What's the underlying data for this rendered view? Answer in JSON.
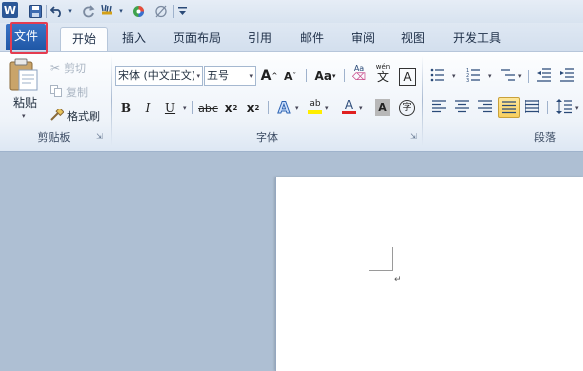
{
  "quick_access": {
    "word_icon_text": "W",
    "icons": [
      "save-icon",
      "undo-icon",
      "redo-icon",
      "format-painter-icon",
      "color-icon",
      "clear-icon",
      "customize-icon"
    ]
  },
  "tabs": {
    "file": "文件",
    "items": [
      "开始",
      "插入",
      "页面布局",
      "引用",
      "邮件",
      "审阅",
      "视图",
      "开发工具"
    ],
    "active": "开始"
  },
  "clipboard": {
    "paste": "粘贴",
    "cut": "剪切",
    "copy": "复制",
    "format_painter": "格式刷",
    "label": "剪贴板"
  },
  "font": {
    "font_name": "宋体 (中文正文)",
    "font_size": "五号",
    "grow": "A",
    "shrink": "A",
    "change_case": "Aa",
    "wen": "wén",
    "wen_char": "文",
    "border_a": "A",
    "bold": "B",
    "italic": "I",
    "underline": "U",
    "strike": "abc",
    "subscript": "x",
    "superscript": "x",
    "sub2": "2",
    "text_effect": "A",
    "highlight": "ab",
    "font_color": "A",
    "shade_a": "A",
    "enclose": "字",
    "label": "字体"
  },
  "paragraph": {
    "label": "段落"
  },
  "colors": {
    "accent_red": "#e43c50",
    "file_tab": "#2b62b3",
    "highlight_yellow": "#ffee00",
    "font_red": "#e02020"
  }
}
